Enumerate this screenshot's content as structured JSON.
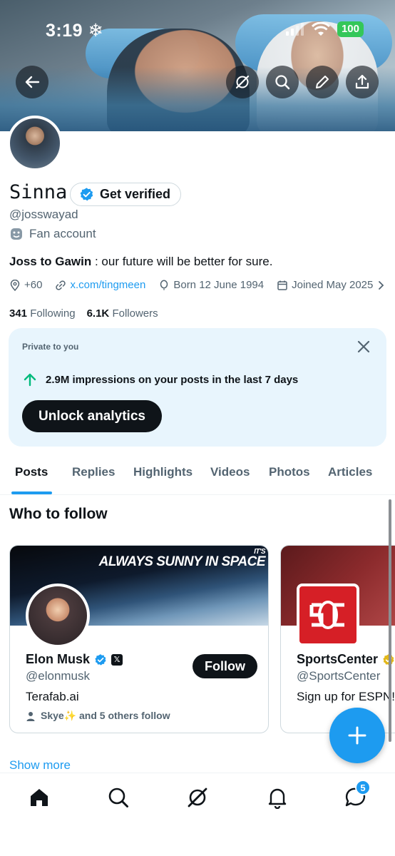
{
  "status_bar": {
    "time": "3:19",
    "battery": "100"
  },
  "profile": {
    "name": "Sinna",
    "get_verified_label": "Get verified",
    "handle": "@josswayad",
    "category": "Fan account",
    "bio_bold": "Joss to Gawin",
    "bio_rest": " : our future will be better for sure.",
    "location": "+60",
    "website": "x.com/tingmeen",
    "birthday": "Born 12 June 1994",
    "joined": "Joined May 2025",
    "following_count": "341",
    "following_label": "Following",
    "followers_count": "6.1K",
    "followers_label": "Followers"
  },
  "private_card": {
    "label": "Private to you",
    "impressions_text": "2.9M impressions on your posts in the last 7 days",
    "button_label": "Unlock analytics"
  },
  "tabs": [
    {
      "label": "Posts",
      "active": true
    },
    {
      "label": "Replies"
    },
    {
      "label": "Highlights"
    },
    {
      "label": "Videos"
    },
    {
      "label": "Photos"
    },
    {
      "label": "Articles"
    }
  ],
  "who_to_follow": {
    "title": "Who to follow",
    "cards": [
      {
        "name": "Elon Musk",
        "handle": "@elonmusk",
        "bio": "Terafab.ai",
        "mutual": "Skye✨ and 5 others follow",
        "button": "Follow",
        "banner_text_small": "IT'S",
        "banner_text": "ALWAYS SUNNY IN SPACE"
      },
      {
        "name": "SportsCenter",
        "handle": "@SportsCenter",
        "bio": "Sign up for ESPN!"
      }
    ],
    "show_more": "Show more"
  },
  "bottom_nav": {
    "messages_badge": "5"
  },
  "colors": {
    "accent": "#1d9bf0",
    "text": "#0f1419",
    "muted": "#536471",
    "private_bg": "#e8f5fd",
    "success": "#00ba7c"
  }
}
